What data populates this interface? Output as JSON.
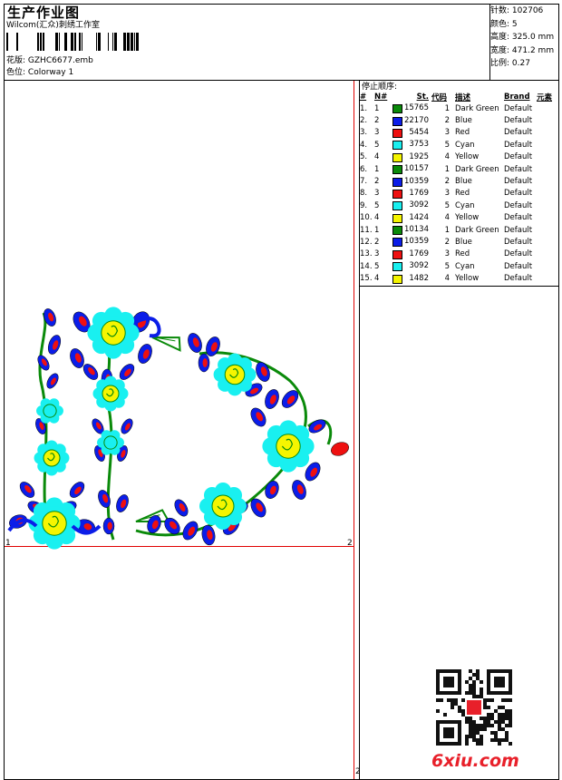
{
  "header": {
    "title": "生产作业图",
    "company": "Wilcom(汇众)刺绣工作室",
    "design_label": "花版:",
    "design_value": "GZHC6677.emb",
    "colorway_label": "色位:",
    "colorway_value": "Colorway 1"
  },
  "stats": [
    {
      "label": "针数:",
      "value": "102706"
    },
    {
      "label": "颜色:",
      "value": "5"
    },
    {
      "label": "高度:",
      "value": "325.0 mm"
    },
    {
      "label": "宽度:",
      "value": "471.2 mm"
    },
    {
      "label": "比例:",
      "value": "0.27"
    }
  ],
  "stop_sequence": {
    "title": "停止顺序:",
    "headers": [
      "#",
      "N#",
      "St.",
      "代码",
      "描述",
      "Brand",
      "元素"
    ],
    "rows": [
      {
        "idx": "1.",
        "n": "1",
        "color": "#0a8a0a",
        "st": "15765",
        "code": "1",
        "desc": "Dark Green",
        "brand": "Default"
      },
      {
        "idx": "2.",
        "n": "2",
        "color": "#0b1de8",
        "st": "22170",
        "code": "2",
        "desc": "Blue",
        "brand": "Default"
      },
      {
        "idx": "3.",
        "n": "3",
        "color": "#ee1010",
        "st": "5454",
        "code": "3",
        "desc": "Red",
        "brand": "Default"
      },
      {
        "idx": "4.",
        "n": "5",
        "color": "#19f0f0",
        "st": "3753",
        "code": "5",
        "desc": "Cyan",
        "brand": "Default"
      },
      {
        "idx": "5.",
        "n": "4",
        "color": "#f5f500",
        "st": "1925",
        "code": "4",
        "desc": "Yellow",
        "brand": "Default"
      },
      {
        "idx": "6.",
        "n": "1",
        "color": "#0a8a0a",
        "st": "10157",
        "code": "1",
        "desc": "Dark Green",
        "brand": "Default"
      },
      {
        "idx": "7.",
        "n": "2",
        "color": "#0b1de8",
        "st": "10359",
        "code": "2",
        "desc": "Blue",
        "brand": "Default"
      },
      {
        "idx": "8.",
        "n": "3",
        "color": "#ee1010",
        "st": "1769",
        "code": "3",
        "desc": "Red",
        "brand": "Default"
      },
      {
        "idx": "9.",
        "n": "5",
        "color": "#19f0f0",
        "st": "3092",
        "code": "5",
        "desc": "Cyan",
        "brand": "Default"
      },
      {
        "idx": "10.",
        "n": "4",
        "color": "#f5f500",
        "st": "1424",
        "code": "4",
        "desc": "Yellow",
        "brand": "Default"
      },
      {
        "idx": "11.",
        "n": "1",
        "color": "#0a8a0a",
        "st": "10134",
        "code": "1",
        "desc": "Dark Green",
        "brand": "Default"
      },
      {
        "idx": "12.",
        "n": "2",
        "color": "#0b1de8",
        "st": "10359",
        "code": "2",
        "desc": "Blue",
        "brand": "Default"
      },
      {
        "idx": "13.",
        "n": "3",
        "color": "#ee1010",
        "st": "1769",
        "code": "3",
        "desc": "Red",
        "brand": "Default"
      },
      {
        "idx": "14.",
        "n": "5",
        "color": "#19f0f0",
        "st": "3092",
        "code": "5",
        "desc": "Cyan",
        "brand": "Default"
      },
      {
        "idx": "15.",
        "n": "4",
        "color": "#f5f500",
        "st": "1482",
        "code": "4",
        "desc": "Yellow",
        "brand": "Default"
      }
    ]
  },
  "axis_labels": {
    "top": "1",
    "right": "2",
    "bottom": "2"
  },
  "watermark": "6xiu.com",
  "icons": {
    "barcode": "barcode-icon",
    "qr": "qr-code-icon"
  }
}
